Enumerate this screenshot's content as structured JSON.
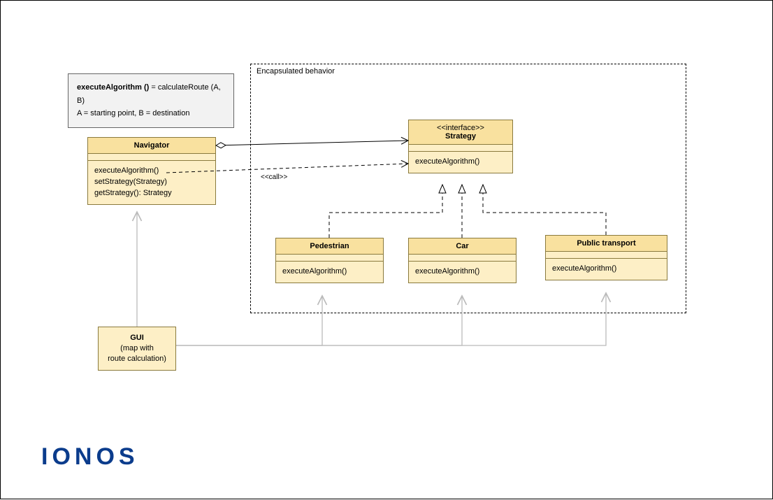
{
  "note": {
    "line1_b": "executeAlgorithm ()",
    "line1_rest": " = calculateRoute (A, B)",
    "line2": "A = starting point, B = destination"
  },
  "frame": {
    "label": "Encapsulated behavior"
  },
  "navigator": {
    "name": "Navigator",
    "op1": "executeAlgorithm()",
    "op2": "setStrategy(Strategy)",
    "op3": "getStrategy(): Strategy"
  },
  "strategy": {
    "stereo": "<<interface>>",
    "name": "Strategy",
    "op1": "executeAlgorithm()"
  },
  "pedestrian": {
    "name": "Pedestrian",
    "op1": "executeAlgorithm()"
  },
  "car": {
    "name": "Car",
    "op1": "executeAlgorithm()"
  },
  "pub": {
    "name": "Public transport",
    "op1": "executeAlgorithm()"
  },
  "gui": {
    "l1": "GUI",
    "l2": "(map with",
    "l3": "route calculation)"
  },
  "call_label": "<<call>>",
  "logo": "IONOS",
  "chart_data": {
    "type": "uml_class_diagram",
    "note": "executeAlgorithm () = calculateRoute (A, B); A = starting point, B = destination",
    "package": {
      "name": "Encapsulated behavior",
      "contains": [
        "Strategy",
        "Pedestrian",
        "Car",
        "Public transport"
      ]
    },
    "classes": [
      {
        "name": "Navigator",
        "operations": [
          "executeAlgorithm()",
          "setStrategy(Strategy)",
          "getStrategy(): Strategy"
        ]
      },
      {
        "name": "Strategy",
        "stereotype": "interface",
        "operations": [
          "executeAlgorithm()"
        ]
      },
      {
        "name": "Pedestrian",
        "operations": [
          "executeAlgorithm()"
        ]
      },
      {
        "name": "Car",
        "operations": [
          "executeAlgorithm()"
        ]
      },
      {
        "name": "Public transport",
        "operations": [
          "executeAlgorithm()"
        ]
      },
      {
        "name": "GUI",
        "note": "map with route calculation"
      }
    ],
    "relationships": [
      {
        "from": "Navigator",
        "to": "Strategy",
        "type": "aggregation"
      },
      {
        "from": "Navigator",
        "to": "Strategy",
        "type": "dependency",
        "label": "<<call>>"
      },
      {
        "from": "Pedestrian",
        "to": "Strategy",
        "type": "realization"
      },
      {
        "from": "Car",
        "to": "Strategy",
        "type": "realization"
      },
      {
        "from": "Public transport",
        "to": "Strategy",
        "type": "realization"
      },
      {
        "from": "GUI",
        "to": "Navigator",
        "type": "dependency"
      },
      {
        "from": "GUI",
        "to": "Pedestrian",
        "type": "dependency"
      },
      {
        "from": "GUI",
        "to": "Car",
        "type": "dependency"
      },
      {
        "from": "GUI",
        "to": "Public transport",
        "type": "dependency"
      }
    ]
  }
}
